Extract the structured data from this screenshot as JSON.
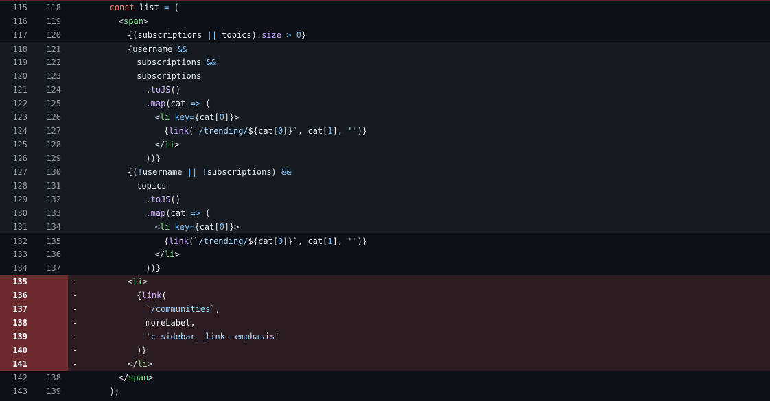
{
  "colors": {
    "background": "#0d1117",
    "deleted_row": "#2b1c21",
    "deleted_gutter": "#6b2b2e",
    "separator": "#30363d"
  },
  "lines": [
    {
      "old": "115",
      "new": "118",
      "type": "ctx",
      "marker": "",
      "indent": 6,
      "tokens": [
        [
          "kw",
          "const"
        ],
        [
          "p",
          " list "
        ],
        [
          "op",
          "="
        ],
        [
          "p",
          " ("
        ]
      ]
    },
    {
      "old": "116",
      "new": "119",
      "type": "ctx",
      "marker": "",
      "indent": 8,
      "tokens": [
        [
          "p",
          "<"
        ],
        [
          "tag",
          "span"
        ],
        [
          "p",
          ">"
        ]
      ]
    },
    {
      "old": "117",
      "new": "120",
      "type": "ctx",
      "marker": "",
      "indent": 10,
      "tokens": [
        [
          "p",
          "{(subscriptions "
        ],
        [
          "op",
          "||"
        ],
        [
          "p",
          " topics)."
        ],
        [
          "prop",
          "size"
        ],
        [
          "p",
          " "
        ],
        [
          "op",
          ">"
        ],
        [
          "p",
          " "
        ],
        [
          "num",
          "0"
        ],
        [
          "p",
          "}"
        ]
      ]
    },
    {
      "old": "118",
      "new": "121",
      "type": "shade",
      "sep": true,
      "marker": "",
      "indent": 10,
      "tokens": [
        [
          "p",
          "{username "
        ],
        [
          "op",
          "&&"
        ]
      ]
    },
    {
      "old": "119",
      "new": "122",
      "type": "shade",
      "marker": "",
      "indent": 12,
      "tokens": [
        [
          "p",
          "subscriptions "
        ],
        [
          "op",
          "&&"
        ]
      ]
    },
    {
      "old": "120",
      "new": "123",
      "type": "shade",
      "marker": "",
      "indent": 12,
      "tokens": [
        [
          "p",
          "subscriptions"
        ]
      ]
    },
    {
      "old": "121",
      "new": "124",
      "type": "shade",
      "marker": "",
      "indent": 14,
      "tokens": [
        [
          "p",
          "."
        ],
        [
          "prop",
          "toJS"
        ],
        [
          "p",
          "()"
        ]
      ]
    },
    {
      "old": "122",
      "new": "125",
      "type": "shade",
      "marker": "",
      "indent": 14,
      "tokens": [
        [
          "p",
          "."
        ],
        [
          "prop",
          "map"
        ],
        [
          "p",
          "(cat "
        ],
        [
          "op",
          "=>"
        ],
        [
          "p",
          " ("
        ]
      ]
    },
    {
      "old": "123",
      "new": "126",
      "type": "shade",
      "marker": "",
      "indent": 16,
      "tokens": [
        [
          "p",
          "<"
        ],
        [
          "tag",
          "li"
        ],
        [
          "p",
          " "
        ],
        [
          "attr",
          "key"
        ],
        [
          "op",
          "="
        ],
        [
          "p",
          "{cat["
        ],
        [
          "num",
          "0"
        ],
        [
          "p",
          "]}>"
        ]
      ]
    },
    {
      "old": "124",
      "new": "127",
      "type": "shade",
      "marker": "",
      "indent": 18,
      "tokens": [
        [
          "p",
          "{"
        ],
        [
          "prop",
          "link"
        ],
        [
          "p",
          "("
        ],
        [
          "str",
          "`/trending/"
        ],
        [
          "p",
          "${cat["
        ],
        [
          "num",
          "0"
        ],
        [
          "p",
          "]}"
        ],
        [
          "str",
          "`"
        ],
        [
          "p",
          ", cat["
        ],
        [
          "num",
          "1"
        ],
        [
          "p",
          "], "
        ],
        [
          "str",
          "''"
        ],
        [
          "p",
          ")}"
        ]
      ]
    },
    {
      "old": "125",
      "new": "128",
      "type": "shade",
      "marker": "",
      "indent": 16,
      "tokens": [
        [
          "p",
          "</"
        ],
        [
          "tag",
          "li"
        ],
        [
          "p",
          ">"
        ]
      ]
    },
    {
      "old": "126",
      "new": "129",
      "type": "shade",
      "marker": "",
      "indent": 14,
      "tokens": [
        [
          "p",
          "))}"
        ]
      ]
    },
    {
      "old": "127",
      "new": "130",
      "type": "shade",
      "marker": "",
      "indent": 10,
      "tokens": [
        [
          "p",
          "{("
        ],
        [
          "op",
          "!"
        ],
        [
          "p",
          "username "
        ],
        [
          "op",
          "||"
        ],
        [
          "p",
          " "
        ],
        [
          "op",
          "!"
        ],
        [
          "p",
          "subscriptions) "
        ],
        [
          "op",
          "&&"
        ]
      ]
    },
    {
      "old": "128",
      "new": "131",
      "type": "shade",
      "marker": "",
      "indent": 12,
      "tokens": [
        [
          "p",
          "topics"
        ]
      ]
    },
    {
      "old": "129",
      "new": "132",
      "type": "shade",
      "marker": "",
      "indent": 14,
      "tokens": [
        [
          "p",
          "."
        ],
        [
          "prop",
          "toJS"
        ],
        [
          "p",
          "()"
        ]
      ]
    },
    {
      "old": "130",
      "new": "133",
      "type": "shade",
      "marker": "",
      "indent": 14,
      "tokens": [
        [
          "p",
          "."
        ],
        [
          "prop",
          "map"
        ],
        [
          "p",
          "(cat "
        ],
        [
          "op",
          "=>"
        ],
        [
          "p",
          " ("
        ]
      ]
    },
    {
      "old": "131",
      "new": "134",
      "type": "shade",
      "marker": "",
      "indent": 16,
      "tokens": [
        [
          "p",
          "<"
        ],
        [
          "tag",
          "li"
        ],
        [
          "p",
          " "
        ],
        [
          "attr",
          "key"
        ],
        [
          "op",
          "="
        ],
        [
          "p",
          "{cat["
        ],
        [
          "num",
          "0"
        ],
        [
          "p",
          "]}>"
        ]
      ]
    },
    {
      "old": "132",
      "new": "135",
      "type": "ctx",
      "sep": true,
      "marker": "",
      "indent": 18,
      "tokens": [
        [
          "p",
          "{"
        ],
        [
          "prop",
          "link"
        ],
        [
          "p",
          "("
        ],
        [
          "str",
          "`/trending/"
        ],
        [
          "p",
          "${cat["
        ],
        [
          "num",
          "0"
        ],
        [
          "p",
          "]}"
        ],
        [
          "str",
          "`"
        ],
        [
          "p",
          ", cat["
        ],
        [
          "num",
          "1"
        ],
        [
          "p",
          "], "
        ],
        [
          "str",
          "''"
        ],
        [
          "p",
          ")}"
        ]
      ]
    },
    {
      "old": "133",
      "new": "136",
      "type": "ctx",
      "marker": "",
      "indent": 16,
      "tokens": [
        [
          "p",
          "</"
        ],
        [
          "tag",
          "li"
        ],
        [
          "p",
          ">"
        ]
      ]
    },
    {
      "old": "134",
      "new": "137",
      "type": "ctx",
      "marker": "",
      "indent": 14,
      "tokens": [
        [
          "p",
          "))}"
        ]
      ]
    },
    {
      "old": "135",
      "new": "",
      "type": "del",
      "marker": "-",
      "indent": 10,
      "tokens": [
        [
          "p",
          "<"
        ],
        [
          "tag",
          "li"
        ],
        [
          "p",
          ">"
        ]
      ]
    },
    {
      "old": "136",
      "new": "",
      "type": "del",
      "marker": "-",
      "indent": 12,
      "tokens": [
        [
          "p",
          "{"
        ],
        [
          "prop",
          "link"
        ],
        [
          "p",
          "("
        ]
      ]
    },
    {
      "old": "137",
      "new": "",
      "type": "del",
      "marker": "-",
      "indent": 14,
      "tokens": [
        [
          "str",
          "`/communities`"
        ],
        [
          "p",
          ","
        ]
      ]
    },
    {
      "old": "138",
      "new": "",
      "type": "del",
      "marker": "-",
      "indent": 14,
      "tokens": [
        [
          "p",
          "moreLabel,"
        ]
      ]
    },
    {
      "old": "139",
      "new": "",
      "type": "del",
      "marker": "-",
      "indent": 14,
      "tokens": [
        [
          "str",
          "'c-sidebar__link--emphasis'"
        ]
      ]
    },
    {
      "old": "140",
      "new": "",
      "type": "del",
      "marker": "-",
      "indent": 12,
      "tokens": [
        [
          "p",
          ")}"
        ]
      ]
    },
    {
      "old": "141",
      "new": "",
      "type": "del",
      "marker": "-",
      "indent": 10,
      "tokens": [
        [
          "p",
          "</"
        ],
        [
          "tag",
          "li"
        ],
        [
          "p",
          ">"
        ]
      ]
    },
    {
      "old": "142",
      "new": "138",
      "type": "ctx",
      "marker": "",
      "indent": 8,
      "tokens": [
        [
          "p",
          "</"
        ],
        [
          "tag",
          "span"
        ],
        [
          "p",
          ">"
        ]
      ]
    },
    {
      "old": "143",
      "new": "139",
      "type": "ctx",
      "marker": "",
      "indent": 6,
      "tokens": [
        [
          "p",
          ");"
        ]
      ]
    }
  ]
}
